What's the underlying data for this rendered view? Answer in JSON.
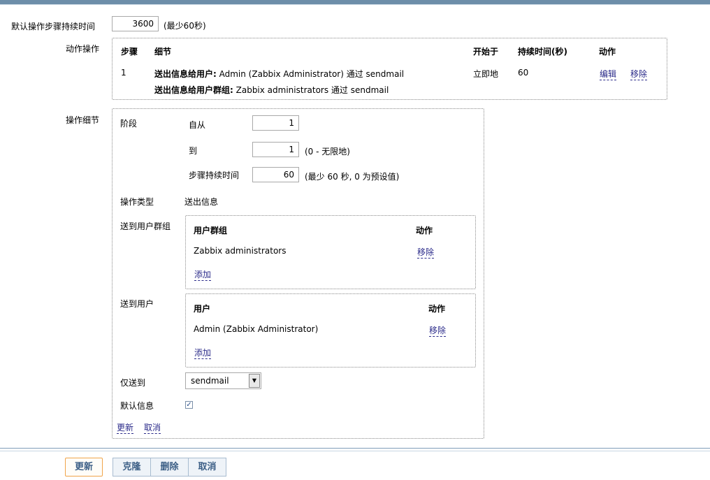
{
  "default_step_duration": {
    "label": "默认操作步骤持续时间",
    "value": "3600",
    "hint": "(最少60秒)"
  },
  "action_operations": {
    "label": "动作操作",
    "headers": {
      "step": "步骤",
      "details": "细节",
      "start": "开始于",
      "duration": "持续时间(秒)",
      "action": "动作"
    },
    "row": {
      "step": "1",
      "detail1_bold": "送出信息给用户:",
      "detail1_text": " Admin (Zabbix Administrator) 通过 sendmail",
      "detail2_bold": "送出信息给用户群组:",
      "detail2_text": " Zabbix administrators 通过 sendmail",
      "start": "立即地",
      "duration": "60",
      "edit": "编辑",
      "remove": "移除"
    }
  },
  "operation_details": {
    "label": "操作细节",
    "stage": {
      "label": "阶段",
      "from_label": "自从",
      "from_value": "1",
      "to_label": "到",
      "to_value": "1",
      "to_hint": "(0 - 无限地)",
      "dur_label": "步骤持续时间",
      "dur_value": "60",
      "dur_hint": "(最少 60 秒, 0 为预设值)"
    },
    "op_type": {
      "label": "操作类型",
      "value": "送出信息"
    },
    "send_groups": {
      "label": "送到用户群组",
      "col_name": "用户群组",
      "col_action": "动作",
      "item": "Zabbix administrators",
      "remove": "移除",
      "add": "添加"
    },
    "send_users": {
      "label": "送到用户",
      "col_name": "用户",
      "col_action": "动作",
      "item": "Admin (Zabbix Administrator)",
      "remove": "移除",
      "add": "添加"
    },
    "send_only": {
      "label": "仅送到",
      "value": "sendmail"
    },
    "default_msg": {
      "label": "默认信息",
      "checked": "✓"
    },
    "update": "更新",
    "cancel": "取消"
  },
  "buttons": {
    "update": "更新",
    "clone": "克隆",
    "delete": "删除",
    "cancel": "取消"
  }
}
